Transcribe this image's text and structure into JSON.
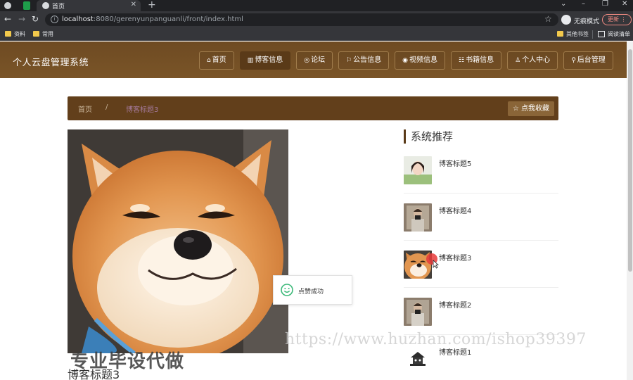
{
  "browser": {
    "tab_title": "首页",
    "url_host": "localhost",
    "url_rest": ":8080/gerenyunpanguanli/front/index.html",
    "incognito_label": "无痕模式",
    "update_label": "更新",
    "bookmarks": [
      "资料",
      "常用"
    ],
    "bookmarks_right": [
      "其他书签",
      "阅读清单"
    ]
  },
  "header": {
    "site_title": "个人云盘管理系统",
    "nav": [
      {
        "label": "首页",
        "icon": "home-icon",
        "glyph": "⌂"
      },
      {
        "label": "博客信息",
        "icon": "blog-icon",
        "glyph": "▥"
      },
      {
        "label": "论坛",
        "icon": "forum-icon",
        "glyph": "◎"
      },
      {
        "label": "公告信息",
        "icon": "flag-icon",
        "glyph": "⚐"
      },
      {
        "label": "视频信息",
        "icon": "video-icon",
        "glyph": "◉"
      },
      {
        "label": "书籍信息",
        "icon": "book-icon",
        "glyph": "☷"
      },
      {
        "label": "个人中心",
        "icon": "user-icon",
        "glyph": "♙"
      },
      {
        "label": "后台管理",
        "icon": "link-icon",
        "glyph": "⚲"
      }
    ],
    "active_index": 1
  },
  "breadcrumb": {
    "home": "首页",
    "separator": "/",
    "current": "博客标题3",
    "favorite_button": "点我收藏"
  },
  "detail": {
    "title": "博客标题3"
  },
  "toast": {
    "text": "点赞成功"
  },
  "sidebar": {
    "heading": "系统推荐",
    "items": [
      {
        "title": "博客标题5",
        "thumb": "portrait-girl"
      },
      {
        "title": "博客标题4",
        "thumb": "mirror-selfie"
      },
      {
        "title": "博客标题3",
        "thumb": "shiba-dog"
      },
      {
        "title": "博客标题2",
        "thumb": "mirror-selfie"
      },
      {
        "title": "博客标题1",
        "thumb": "cartoon-logo"
      }
    ]
  },
  "watermark": {
    "big": "专业毕设代做",
    "url": "https://www.huzhan.com/ishop39397"
  },
  "colors": {
    "header_brown": "#7a5528",
    "breadcrumb_brown": "#623f1b",
    "active_nav": "#5a3a18",
    "toast_icon": "#3cb979"
  }
}
